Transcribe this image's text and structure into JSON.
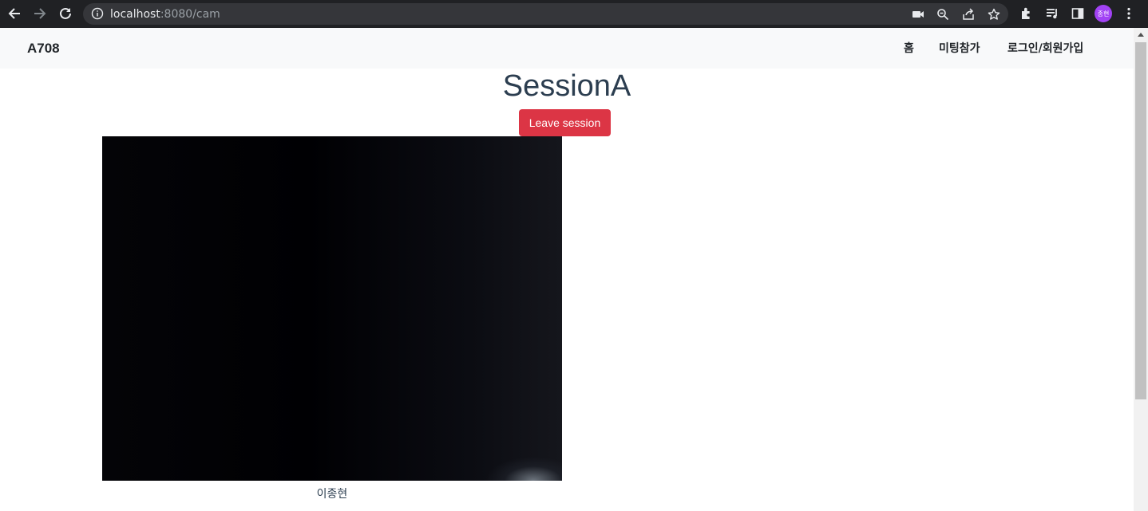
{
  "browser": {
    "url_host": "localhost",
    "url_rest": ":8080/cam",
    "profile_initials": "종현",
    "icons": [
      "back-arrow-icon",
      "forward-arrow-icon",
      "reload-icon",
      "info-icon",
      "camera-icon",
      "zoom-icon",
      "share-icon",
      "star-icon",
      "extensions-icon",
      "media-icon",
      "side-panel-icon",
      "menu-icon"
    ]
  },
  "navbar": {
    "brand": "A708",
    "links": [
      "홈",
      "미팅참가",
      "로그인/회원가입"
    ]
  },
  "session": {
    "title": "SessionA",
    "leave_label": "Leave session",
    "participant_name": "이종현"
  },
  "colors": {
    "leave_button": "#dc3545",
    "title_text": "#2c3e50",
    "navbar_bg": "#f8f9fa",
    "chrome_bg": "#202124",
    "avatar": "#a142f4"
  }
}
